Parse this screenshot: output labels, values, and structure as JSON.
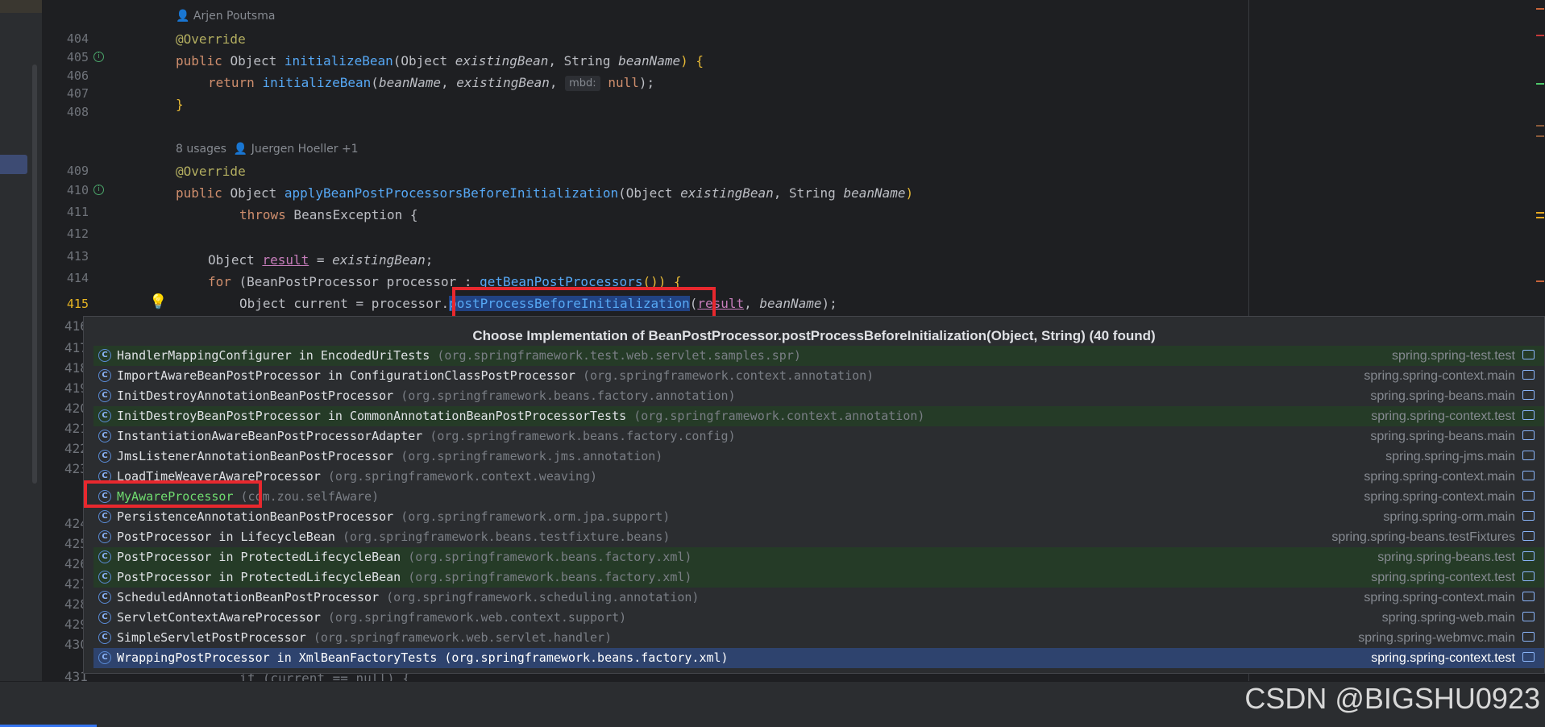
{
  "editor": {
    "author_hint_1": "Arjen Poutsma",
    "usages_hint": "8 usages",
    "author_hint_2": "Juergen Hoeller +1",
    "line_numbers": [
      "404",
      "405",
      "406",
      "407",
      "408",
      "409",
      "410",
      "411",
      "412",
      "413",
      "414",
      "415"
    ],
    "popup_gutter_peek": [
      "416",
      "417",
      "418",
      "419",
      "420",
      "421",
      "422",
      "423",
      "424",
      "425",
      "426",
      "427",
      "428",
      "429",
      "430",
      "431"
    ],
    "code": {
      "l404": "@Override",
      "l405_kw": "public",
      "l405_type": "Object",
      "l405_fn": "initializeBean",
      "l405_rest_a": "(Object ",
      "l405_p1": "existingBean",
      "l405_rest_b": ", String ",
      "l405_p2": "beanName",
      "l405_end": ") {",
      "l406_kw": "return",
      "l406_fn": "initializeBean",
      "l406_a": "(",
      "l406_p1": "beanName",
      "l406_b": ", ",
      "l406_p2": "existingBean",
      "l406_c": ", ",
      "l406_inlay": "mbd:",
      "l406_null": "null",
      "l406_end": ");",
      "l407": "}",
      "l409": "@Override",
      "l410_kw": "public",
      "l410_type": "Object",
      "l410_fn": "applyBeanPostProcessorsBeforeInitialization",
      "l410_a": "(Object ",
      "l410_p1": "existingBean",
      "l410_b": ", String ",
      "l410_p2": "beanName",
      "l410_end": ")",
      "l411_kw": "throws",
      "l411_rest": " BeansException {",
      "l413_type": "Object ",
      "l413_var": "result",
      "l413_eq": " = ",
      "l413_p": "existingBean",
      "l413_end": ";",
      "l414_kw": "for",
      "l414_a": " (BeanPostProcessor processor : ",
      "l414_fn": "getBeanPostProcessors",
      "l414_end": "()) {",
      "l415_a": "Object current = processor.",
      "l415_fn": "postProcessBeforeInitialization",
      "l415_b": "(",
      "l415_var": "result",
      "l415_c": ", ",
      "l415_p": "beanName",
      "l415_end": ");",
      "l431_peek": "if (current == null) {"
    }
  },
  "popup": {
    "title": "Choose Implementation of BeanPostProcessor.postProcessBeforeInitialization(Object, String) (40 found)",
    "icon_letter": "C",
    "rows": [
      {
        "name": "HandlerMappingConfigurer in EncodedUriTests",
        "pkg": "(org.springframework.test.web.servlet.samples.spr)",
        "module": "spring.spring-test.test",
        "test": true
      },
      {
        "name": "ImportAwareBeanPostProcessor in ConfigurationClassPostProcessor",
        "pkg": "(org.springframework.context.annotation)",
        "module": "spring.spring-context.main",
        "test": false
      },
      {
        "name": "InitDestroyAnnotationBeanPostProcessor",
        "pkg": "(org.springframework.beans.factory.annotation)",
        "module": "spring.spring-beans.main",
        "test": false
      },
      {
        "name": "InitDestroyBeanPostProcessor in CommonAnnotationBeanPostProcessorTests",
        "pkg": "(org.springframework.context.annotation)",
        "module": "spring.spring-context.test",
        "test": true
      },
      {
        "name": "InstantiationAwareBeanPostProcessorAdapter",
        "pkg": "(org.springframework.beans.factory.config)",
        "module": "spring.spring-beans.main",
        "test": false
      },
      {
        "name": "JmsListenerAnnotationBeanPostProcessor",
        "pkg": "(org.springframework.jms.annotation)",
        "module": "spring.spring-jms.main",
        "test": false
      },
      {
        "name": "LoadTimeWeaverAwareProcessor",
        "pkg": "(org.springframework.context.weaving)",
        "module": "spring.spring-context.main",
        "test": false
      },
      {
        "name": "MyAwareProcessor",
        "pkg": "(com.zou.selfAware)",
        "module": "spring.spring-context.main",
        "test": false
      },
      {
        "name": "PersistenceAnnotationBeanPostProcessor",
        "pkg": "(org.springframework.orm.jpa.support)",
        "module": "spring.spring-orm.main",
        "test": false
      },
      {
        "name": "PostProcessor in LifecycleBean",
        "pkg": "(org.springframework.beans.testfixture.beans)",
        "module": "spring.spring-beans.testFixtures",
        "test": false
      },
      {
        "name": "PostProcessor in ProtectedLifecycleBean",
        "pkg": "(org.springframework.beans.factory.xml)",
        "module": "spring.spring-beans.test",
        "test": true
      },
      {
        "name": "PostProcessor in ProtectedLifecycleBean",
        "pkg": "(org.springframework.beans.factory.xml)",
        "module": "spring.spring-context.test",
        "test": true
      },
      {
        "name": "ScheduledAnnotationBeanPostProcessor",
        "pkg": "(org.springframework.scheduling.annotation)",
        "module": "spring.spring-context.main",
        "test": false
      },
      {
        "name": "ServletContextAwareProcessor",
        "pkg": "(org.springframework.web.context.support)",
        "module": "spring.spring-web.main",
        "test": false
      },
      {
        "name": "SimpleServletPostProcessor",
        "pkg": "(org.springframework.web.servlet.handler)",
        "module": "spring.spring-webmvc.main",
        "test": false
      },
      {
        "name": "WrappingPostProcessor in XmlBeanFactoryTests",
        "pkg": "(org.springframework.beans.factory.xml)",
        "module": "spring.spring-context.test",
        "test": true,
        "selected": true
      }
    ]
  },
  "watermark": "CSDN @BIGSHU0923",
  "colors": {
    "highlight_box": "#e8282e",
    "selected_row": "#2e436e",
    "test_row": "#253b27",
    "keyword": "#cf8e6d",
    "annotation": "#b3ae60",
    "function": "#56a8f5"
  }
}
